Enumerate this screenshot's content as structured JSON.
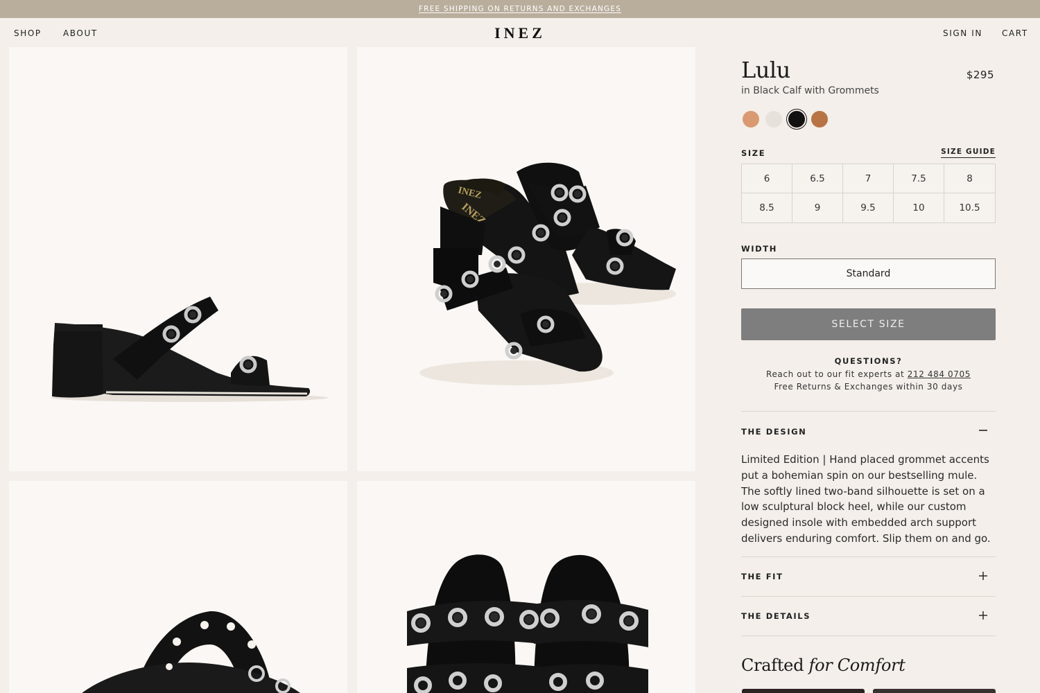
{
  "promo": {
    "text": "FREE SHIPPING ON RETURNS AND EXCHANGES"
  },
  "header": {
    "nav_left": [
      "SHOP",
      "ABOUT"
    ],
    "logo": "INEZ",
    "nav_right": [
      "SIGN IN",
      "CART"
    ]
  },
  "gallery": {
    "images": [
      "side-view-mule",
      "pair-angle-view",
      "top-straps-view",
      "front-toe-view"
    ]
  },
  "product": {
    "name": "Lulu",
    "price": "$295",
    "variant": "in Black Calf with Grommets",
    "swatches": [
      {
        "name": "tan",
        "color": "#d99a72",
        "selected": false
      },
      {
        "name": "cream",
        "color": "#e6e2db",
        "selected": false
      },
      {
        "name": "black",
        "color": "#111111",
        "selected": true
      },
      {
        "name": "cognac",
        "color": "#b87345",
        "selected": false
      }
    ],
    "size_label": "SIZE",
    "size_guide": "SIZE GUIDE",
    "sizes": [
      "6",
      "6.5",
      "7",
      "7.5",
      "8",
      "8.5",
      "9",
      "9.5",
      "10",
      "10.5"
    ],
    "width_label": "WIDTH",
    "width_value": "Standard",
    "cta": "SELECT SIZE"
  },
  "questions": {
    "title": "QUESTIONS?",
    "line1_prefix": "Reach out to our fit experts at ",
    "phone": "212 484 0705",
    "line2": "Free Returns & Exchanges within 30 days"
  },
  "accordions": {
    "design": {
      "title": "THE DESIGN",
      "text": "Limited Edition | Hand placed grommet accents put a bohemian spin on our bestselling mule. The softly lined two-band silhouette is set on a low sculptural block heel, while our custom designed insole with embedded arch support delivers enduring comfort. Slip them on and go."
    },
    "fit": {
      "title": "THE FIT"
    },
    "details": {
      "title": "THE DETAILS"
    }
  },
  "crafted": {
    "regular": "Crafted",
    "italic": "for Comfort"
  }
}
